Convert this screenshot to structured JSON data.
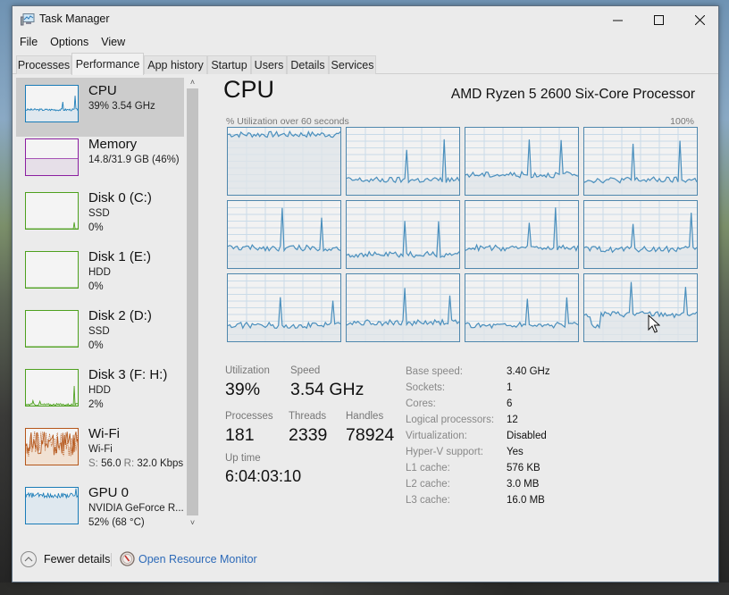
{
  "window": {
    "title": "Task Manager",
    "controls": {
      "minimize": "minimize",
      "maximize": "maximize",
      "close": "close"
    }
  },
  "menu": [
    "File",
    "Options",
    "View"
  ],
  "tabs": [
    {
      "label": "Processes",
      "active": false
    },
    {
      "label": "Performance",
      "active": true
    },
    {
      "label": "App history",
      "active": false
    },
    {
      "label": "Startup",
      "active": false
    },
    {
      "label": "Users",
      "active": false
    },
    {
      "label": "Details",
      "active": false
    },
    {
      "label": "Services",
      "active": false
    }
  ],
  "sidebar": {
    "items": [
      {
        "title": "CPU",
        "line1": "39%  3.54 GHz",
        "line2": "",
        "selected": true,
        "color": "#1a7cb8",
        "fill": "#dfe8ef",
        "graph_type": "cpu"
      },
      {
        "title": "Memory",
        "line1": "14.8/31.9 GB (46%)",
        "line2": "",
        "selected": false,
        "color": "#8b1ea0",
        "fill": "#e6dfe8",
        "graph_type": "memory"
      },
      {
        "title": "Disk 0 (C:)",
        "line1": "SSD",
        "line2": "0%",
        "selected": false,
        "color": "#4da01e",
        "fill": "#e4eedd",
        "graph_type": "disk0"
      },
      {
        "title": "Disk 1 (E:)",
        "line1": "HDD",
        "line2": "0%",
        "selected": false,
        "color": "#4da01e",
        "fill": "#e4eedd",
        "graph_type": "flat"
      },
      {
        "title": "Disk 2 (D:)",
        "line1": "SSD",
        "line2": "0%",
        "selected": false,
        "color": "#4da01e",
        "fill": "#e4eedd",
        "graph_type": "flat"
      },
      {
        "title": "Disk 3 (F: H:)",
        "line1": "HDD",
        "line2": "2%",
        "selected": false,
        "color": "#4da01e",
        "fill": "#e4eedd",
        "graph_type": "disk3"
      },
      {
        "title": "Wi-Fi",
        "line1": "Wi-Fi",
        "line2_send_label": "S:",
        "line2_send": "56.0",
        "line2_recv_label": "R:",
        "line2_recv": "32.0 Kbps",
        "selected": false,
        "color": "#b5561a",
        "fill": "#f1e1d3",
        "graph_type": "wifi"
      },
      {
        "title": "GPU 0",
        "line1": "NVIDIA GeForce R...",
        "line2": "52%  (68 °C)",
        "selected": false,
        "color": "#1a7cb8",
        "fill": "#dfe8ef",
        "graph_type": "gpu"
      }
    ]
  },
  "cpu": {
    "title": "CPU",
    "model": "AMD Ryzen 5 2600 Six-Core Processor",
    "graph_label": "% Utilization over 60 seconds",
    "graph_max": "100%",
    "line_color": "#4a8fbd",
    "grid_color": "#c9dbe8",
    "border_color": "#4f87ad",
    "fill_color": "#dfe4e8",
    "core_levels_percent": [
      90,
      22,
      30,
      22,
      30,
      20,
      30,
      28,
      24,
      28,
      24,
      40
    ],
    "stats": {
      "utilization_label": "Utilization",
      "utilization": "39%",
      "speed_label": "Speed",
      "speed": "3.54 GHz",
      "processes_label": "Processes",
      "processes": "181",
      "threads_label": "Threads",
      "threads": "2339",
      "handles_label": "Handles",
      "handles": "78924",
      "uptime_label": "Up time",
      "uptime": "6:04:03:10"
    },
    "specs": [
      {
        "label": "Base speed:",
        "value": "3.40 GHz"
      },
      {
        "label": "Sockets:",
        "value": "1"
      },
      {
        "label": "Cores:",
        "value": "6"
      },
      {
        "label": "Logical processors:",
        "value": "12"
      },
      {
        "label": "Virtualization:",
        "value": "Disabled"
      },
      {
        "label": "Hyper-V support:",
        "value": "Yes"
      },
      {
        "label": "L1 cache:",
        "value": "576 KB"
      },
      {
        "label": "L2 cache:",
        "value": "3.0 MB"
      },
      {
        "label": "L3 cache:",
        "value": "16.0 MB"
      }
    ]
  },
  "footer": {
    "fewer_details": "Fewer details",
    "open_resource_monitor": "Open Resource Monitor"
  }
}
